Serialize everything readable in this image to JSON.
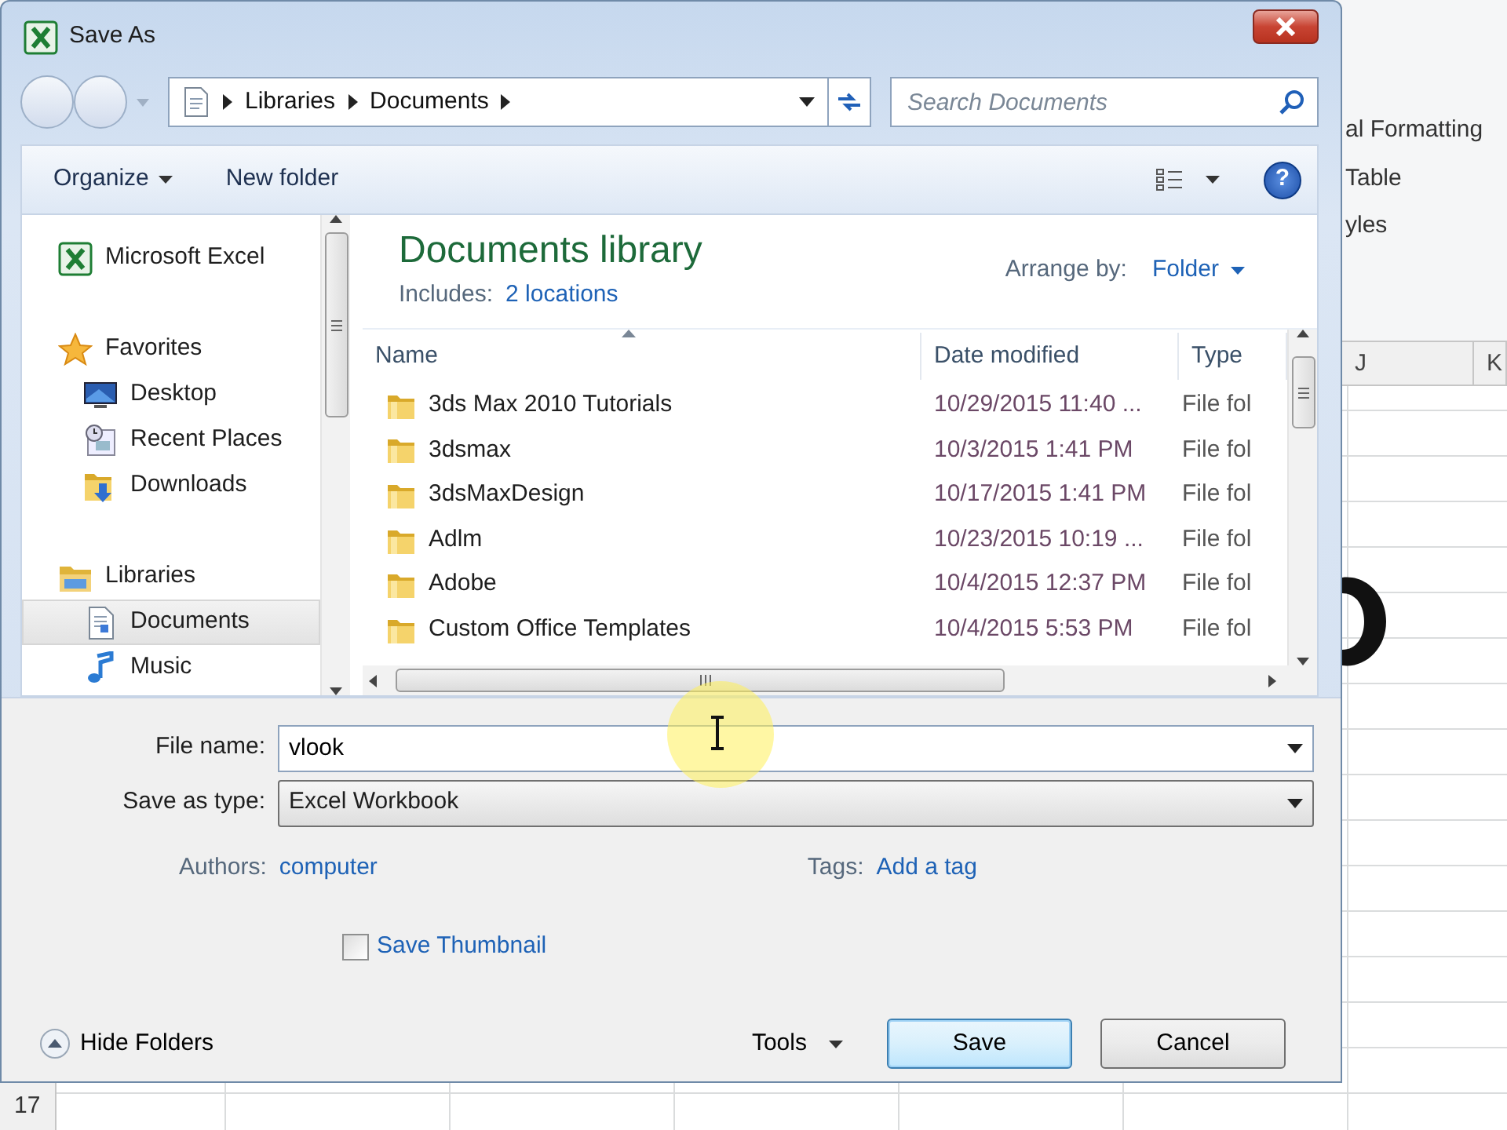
{
  "window": {
    "title": "Save As"
  },
  "address": {
    "crumbs": [
      "Libraries",
      "Documents"
    ]
  },
  "search": {
    "placeholder": "Search Documents"
  },
  "toolbar": {
    "organize": "Organize",
    "new_folder": "New folder",
    "help": "?"
  },
  "nav": [
    {
      "label": "Microsoft Excel",
      "kind": "excel",
      "selected": false
    },
    {
      "label": "Favorites",
      "kind": "star",
      "selected": false,
      "children": [
        {
          "label": "Desktop",
          "kind": "desktop",
          "selected": false
        },
        {
          "label": "Recent Places",
          "kind": "recent",
          "selected": false
        },
        {
          "label": "Downloads",
          "kind": "downloads",
          "selected": false
        }
      ]
    },
    {
      "label": "Libraries",
      "kind": "libraries",
      "selected": false,
      "children": [
        {
          "label": "Documents",
          "kind": "documents",
          "selected": true
        },
        {
          "label": "Music",
          "kind": "music",
          "selected": false
        }
      ]
    }
  ],
  "library": {
    "title": "Documents library",
    "includes_label": "Includes:",
    "includes_link": "2 locations",
    "arrange_label": "Arrange by:",
    "arrange_value": "Folder"
  },
  "table": {
    "columns": [
      "Name",
      "Date modified",
      "Type"
    ],
    "rows": [
      {
        "name": "3ds Max 2010 Tutorials",
        "date": "10/29/2015 11:40 ...",
        "type": "File fol"
      },
      {
        "name": "3dsmax",
        "date": "10/3/2015 1:41 PM",
        "type": "File fol"
      },
      {
        "name": "3dsMaxDesign",
        "date": "10/17/2015 1:41 PM",
        "type": "File fol"
      },
      {
        "name": "Adlm",
        "date": "10/23/2015 10:19 ...",
        "type": "File fol"
      },
      {
        "name": "Adobe",
        "date": "10/4/2015 12:37 PM",
        "type": "File fol"
      },
      {
        "name": "Custom Office Templates",
        "date": "10/4/2015 5:53 PM",
        "type": "File fol"
      }
    ]
  },
  "form": {
    "file_name_label": "File name:",
    "file_name": "vlook",
    "type_label": "Save as type:",
    "type_value": "Excel Workbook",
    "authors_label": "Authors:",
    "authors": "computer",
    "tags_label": "Tags:",
    "tags": "Add a tag",
    "thumbnail": {
      "label": "Save Thumbnail",
      "checked": false
    }
  },
  "footer": {
    "hide_folders": "Hide Folders",
    "tools": "Tools",
    "buttons": [
      "Save",
      "Cancel"
    ]
  },
  "excel": {
    "ribbon": [
      "al Formatting",
      "Table",
      "yles"
    ],
    "columns": [
      "J",
      "K"
    ],
    "row_number": "17"
  }
}
